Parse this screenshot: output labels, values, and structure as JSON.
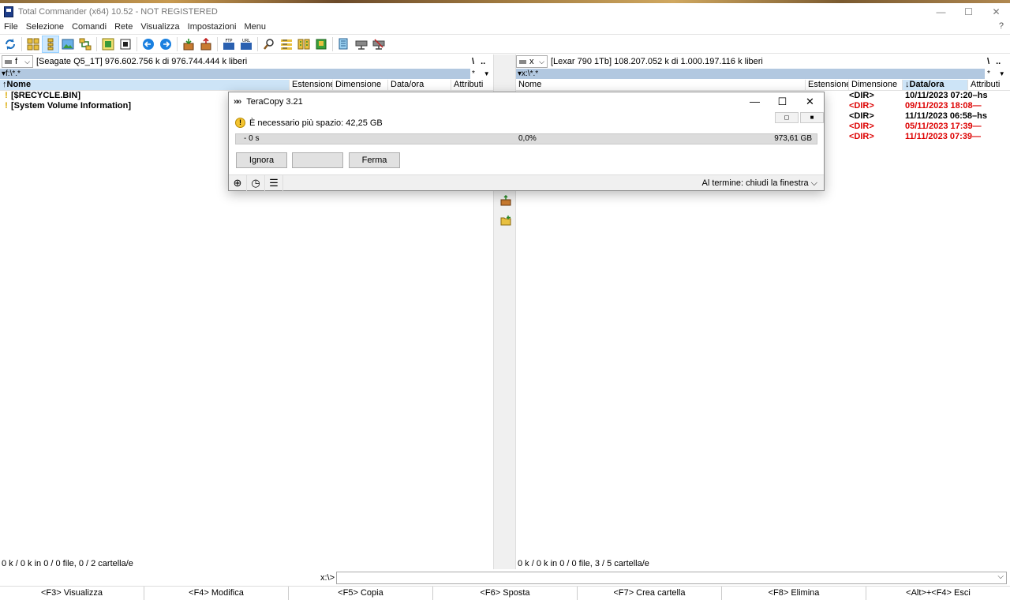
{
  "window": {
    "title": "Total Commander (x64) 10.52 - NOT REGISTERED",
    "minimize": "—",
    "maximize": "☐",
    "close": "✕"
  },
  "menu": [
    "File",
    "Selezione",
    "Comandi",
    "Rete",
    "Visualizza",
    "Impostazioni",
    "Menu"
  ],
  "menu_help": "?",
  "toolbar_icons": [
    "refresh-icon",
    "brief-view-icon",
    "tree-view-icon",
    "thumbnails-icon",
    "sync-dirs-icon",
    "compare-icon",
    "notepad-icon",
    "back-icon",
    "forward-icon",
    "pack-icon",
    "unpack-icon",
    "ftp-connect-icon",
    "url-connect-icon",
    "find-icon",
    "multi-rename-icon",
    "compare-dirs-icon",
    "archive-icon",
    "copy-names-icon",
    "net-drive-icon",
    "disconnect-icon"
  ],
  "left": {
    "drive_letter": "f",
    "drive_info": "[Seagate Q5_1T]  976.602.756 k di 976.744.444 k liberi",
    "nav_root": "\\",
    "nav_up": "..",
    "path": "▾f:\\*.*",
    "path_star": "*",
    "path_arrow": "▼",
    "columns": {
      "name": "↑Nome",
      "ext": "Estensione",
      "size": "Dimensione",
      "date": "Data/ora",
      "attr": "Attributi"
    },
    "rows": [
      {
        "name": "[$RECYCLE.BIN]"
      },
      {
        "name": "[System Volume Information]"
      }
    ],
    "status": "0 k / 0 k in 0 / 0 file, 0 / 2 cartella/e"
  },
  "right": {
    "drive_letter": "x",
    "drive_info": "[Lexar 790 1Tb]  108.207.052 k di 1.000.197.116 k liberi",
    "nav_root": "\\",
    "nav_up": "..",
    "path": "▾x:\\*.*",
    "path_star": "*",
    "path_arrow": "▼",
    "columns": {
      "name": "Nome",
      "ext": "Estensione",
      "size": "Dimensione",
      "date": "↓Data/ora",
      "attr": "Attributi"
    },
    "rows": [
      {
        "size": "<DIR>",
        "date": "10/11/2023 07:20–hs",
        "red": false
      },
      {
        "size": "<DIR>",
        "date": "09/11/2023 18:08—",
        "red": true
      },
      {
        "size": "<DIR>",
        "date": "11/11/2023 06:58–hs",
        "red": false
      },
      {
        "size": "<DIR>",
        "date": "05/11/2023 17:39—",
        "red": true
      },
      {
        "size": "<DIR>",
        "date": "11/11/2023 07:39—",
        "red": true
      }
    ],
    "status": "0 k / 0 k in 0 / 0 file, 3 / 5 cartella/e"
  },
  "cmdline": {
    "prompt": "x:\\>",
    "value": "",
    "dropdown": "⌵"
  },
  "fkeys": [
    "<F3> Visualizza",
    "<F4> Modifica",
    "<F5> Copia",
    "<F6> Sposta",
    "<F7> Crea cartella",
    "<F8> Elimina",
    "<Alt>+<F4> Esci"
  ],
  "teracopy": {
    "logo": "»»",
    "title": "TeraCopy 3.21",
    "minimize": "—",
    "maximize": "☐",
    "close": "✕",
    "message": "È necessario più spazio: 42,25 GB",
    "warn_glyph": "!",
    "mini_button_1": "◻",
    "mini_button_2": "■",
    "progress": {
      "left": "- 0 s",
      "percent": "0,0%",
      "right": "973,61 GB",
      "value": 0.0
    },
    "buttons": {
      "ignore": "Ignora",
      "middle": "",
      "stop": "Ferma"
    },
    "footer_icons": {
      "add": "⊕",
      "history": "◷",
      "menu": "☰"
    },
    "on_finish": "Al termine: chiudi la finestra ⌵"
  },
  "colors": {
    "path_bar": "#b2c8e0",
    "red_text": "#d00000",
    "progress": "#06b025"
  }
}
